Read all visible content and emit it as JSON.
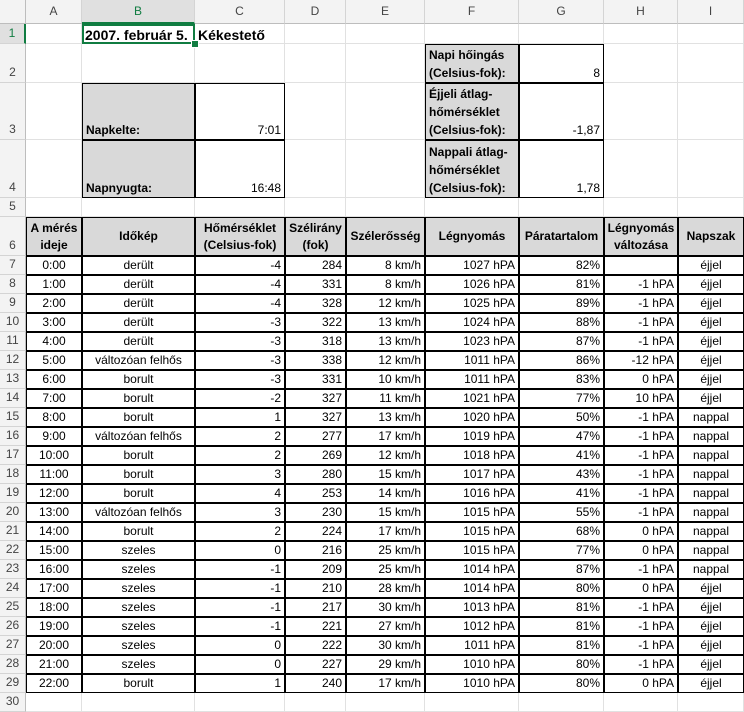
{
  "columns": [
    "A",
    "B",
    "C",
    "D",
    "E",
    "F",
    "G",
    "H",
    "I"
  ],
  "row_numbers": [
    "1",
    "2",
    "3",
    "4",
    "5",
    "6",
    "7",
    "8",
    "9",
    "10",
    "11",
    "12",
    "13",
    "14",
    "15",
    "16",
    "17",
    "18",
    "19",
    "20",
    "21",
    "22",
    "23",
    "24",
    "25",
    "26",
    "27",
    "28",
    "29",
    "30"
  ],
  "selected_cell": "B1",
  "title": {
    "date": "2007. február 5.",
    "place": "Kékestető"
  },
  "sun": {
    "sunrise_label": "Napkelte:",
    "sunrise_value": "7:01",
    "sunset_label": "Napnyugta:",
    "sunset_value": "16:48"
  },
  "stats": [
    {
      "label": "Napi hőingás (Celsius-fok):",
      "value": "8"
    },
    {
      "label": "Éjjeli átlag-hőmérséklet (Celsius-fok):",
      "value": "-1,87"
    },
    {
      "label": "Nappali átlag-hőmérséklet (Celsius-fok):",
      "value": "1,78"
    }
  ],
  "table": {
    "headers": [
      "A mérés ideje",
      "Időkép",
      "Hőmérséklet (Celsius-fok)",
      "Szélirány (fok)",
      "Szélerősség",
      "Légnyomás",
      "Páratartalom",
      "Légnyomás változása",
      "Napszak"
    ],
    "rows": [
      [
        "0:00",
        "derült",
        "-4",
        "284",
        "8 km/h",
        "1027 hPA",
        "82%",
        "",
        "éjjel"
      ],
      [
        "1:00",
        "derült",
        "-4",
        "331",
        "8 km/h",
        "1026 hPA",
        "81%",
        "-1 hPA",
        "éjjel"
      ],
      [
        "2:00",
        "derült",
        "-4",
        "328",
        "12 km/h",
        "1025 hPA",
        "89%",
        "-1 hPA",
        "éjjel"
      ],
      [
        "3:00",
        "derült",
        "-3",
        "322",
        "13 km/h",
        "1024 hPA",
        "88%",
        "-1 hPA",
        "éjjel"
      ],
      [
        "4:00",
        "derült",
        "-3",
        "318",
        "13 km/h",
        "1023 hPA",
        "87%",
        "-1 hPA",
        "éjjel"
      ],
      [
        "5:00",
        "változóan felhős",
        "-3",
        "338",
        "12 km/h",
        "1011 hPA",
        "86%",
        "-12 hPA",
        "éjjel"
      ],
      [
        "6:00",
        "borult",
        "-3",
        "331",
        "10 km/h",
        "1011 hPA",
        "83%",
        "0 hPA",
        "éjjel"
      ],
      [
        "7:00",
        "borult",
        "-2",
        "327",
        "11 km/h",
        "1021 hPA",
        "77%",
        "10 hPA",
        "éjjel"
      ],
      [
        "8:00",
        "borult",
        "1",
        "327",
        "13 km/h",
        "1020 hPA",
        "50%",
        "-1 hPA",
        "nappal"
      ],
      [
        "9:00",
        "változóan felhős",
        "2",
        "277",
        "17 km/h",
        "1019 hPA",
        "47%",
        "-1 hPA",
        "nappal"
      ],
      [
        "10:00",
        "borult",
        "2",
        "269",
        "12 km/h",
        "1018 hPA",
        "41%",
        "-1 hPA",
        "nappal"
      ],
      [
        "11:00",
        "borult",
        "3",
        "280",
        "15 km/h",
        "1017 hPA",
        "43%",
        "-1 hPA",
        "nappal"
      ],
      [
        "12:00",
        "borult",
        "4",
        "253",
        "14 km/h",
        "1016 hPA",
        "41%",
        "-1 hPA",
        "nappal"
      ],
      [
        "13:00",
        "változóan felhős",
        "3",
        "230",
        "15 km/h",
        "1015 hPA",
        "55%",
        "-1 hPA",
        "nappal"
      ],
      [
        "14:00",
        "borult",
        "2",
        "224",
        "17 km/h",
        "1015 hPA",
        "68%",
        "0 hPA",
        "nappal"
      ],
      [
        "15:00",
        "szeles",
        "0",
        "216",
        "25 km/h",
        "1015 hPA",
        "77%",
        "0 hPA",
        "nappal"
      ],
      [
        "16:00",
        "szeles",
        "-1",
        "209",
        "25 km/h",
        "1014 hPA",
        "87%",
        "-1 hPA",
        "nappal"
      ],
      [
        "17:00",
        "szeles",
        "-1",
        "210",
        "28 km/h",
        "1014 hPA",
        "80%",
        "0 hPA",
        "éjjel"
      ],
      [
        "18:00",
        "szeles",
        "-1",
        "217",
        "30 km/h",
        "1013 hPA",
        "81%",
        "-1 hPA",
        "éjjel"
      ],
      [
        "19:00",
        "szeles",
        "-1",
        "221",
        "27 km/h",
        "1012 hPA",
        "81%",
        "-1 hPA",
        "éjjel"
      ],
      [
        "20:00",
        "szeles",
        "0",
        "222",
        "30 km/h",
        "1011 hPA",
        "81%",
        "-1 hPA",
        "éjjel"
      ],
      [
        "21:00",
        "szeles",
        "0",
        "227",
        "29 km/h",
        "1010 hPA",
        "80%",
        "-1 hPA",
        "éjjel"
      ],
      [
        "22:00",
        "borult",
        "1",
        "240",
        "17 km/h",
        "1010 hPA",
        "80%",
        "0 hPA",
        "éjjel"
      ]
    ]
  }
}
